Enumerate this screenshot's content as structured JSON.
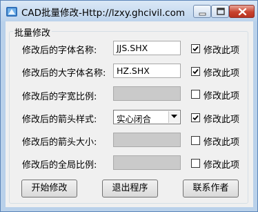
{
  "window": {
    "title": "CAD批量修改-Http://lzxy.ghcivil.com",
    "icon": "cad-app-icon"
  },
  "group": {
    "title": "批量修改"
  },
  "rows": [
    {
      "label": "修改后的字体名称:",
      "value": "JJS.SHX",
      "enabled": true,
      "checked": true,
      "check_label": "修改此项"
    },
    {
      "label": "修改后的大字体名称:",
      "value": "HZ.SHX",
      "enabled": true,
      "checked": true,
      "check_label": "修改此项"
    },
    {
      "label": "修改后的字宽比例:",
      "value": "",
      "enabled": false,
      "checked": false,
      "check_label": "修改此项"
    },
    {
      "label": "修改后的箭头样式:",
      "value": "实心闭合",
      "enabled": true,
      "checked": true,
      "check_label": "修改此项"
    },
    {
      "label": "修改后的箭头大小:",
      "value": "",
      "enabled": false,
      "checked": false,
      "check_label": "修改此项"
    },
    {
      "label": "修改后的全局比例:",
      "value": "",
      "enabled": false,
      "checked": false,
      "check_label": "修改此项"
    }
  ],
  "buttons": {
    "start": "开始修改",
    "exit": "退出程序",
    "contact": "联系作者"
  },
  "colors": {
    "frame": "#b9d1ea",
    "close_button": "#c8432f",
    "disabled_field": "#cacaca"
  }
}
